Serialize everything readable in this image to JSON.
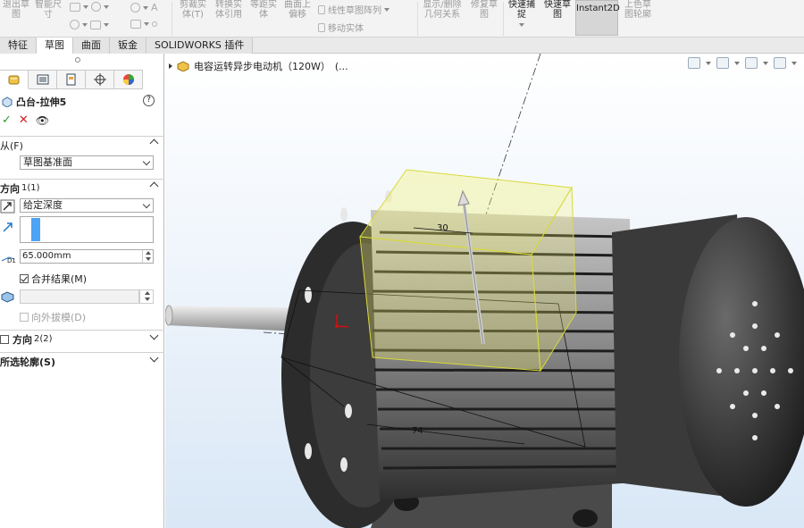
{
  "ribbon": {
    "groups": [
      {
        "line1": "退出草",
        "line2": "图"
      },
      {
        "line1": "智能尺",
        "line2": "寸"
      },
      {
        "line1": "剪裁实",
        "line2": "体(T)"
      },
      {
        "line1": "转换实",
        "line2": "体引用"
      },
      {
        "line1": "等距实",
        "line2": "体"
      },
      {
        "line1": "曲面上",
        "line2": "偏移"
      },
      {
        "line1": "显示/删除",
        "line2": "几何关系"
      },
      {
        "line1": "修复草",
        "line2": "图"
      },
      {
        "line1": "快速捕",
        "line2": "捉"
      },
      {
        "line1": "快速草",
        "line2": "图"
      },
      {
        "line1": "上色草",
        "line2": "图轮廓"
      }
    ],
    "linear_pattern": "线性草图阵列",
    "move_entity": "移动实体",
    "instant2d": "Instant2D"
  },
  "tabs": [
    "特征",
    "草图",
    "曲面",
    "钣金",
    "SOLIDWORKS 插件"
  ],
  "active_tab": "草图",
  "panel": {
    "feature_title": "凸台-拉伸5",
    "help": "?",
    "from": {
      "label": "从(F)",
      "value": "草图基准面"
    },
    "direction1": {
      "label": "方向",
      "sub": "1(1)",
      "end_condition": "给定深度",
      "depth": "65.000mm",
      "merge": "合并结果(M)",
      "draft": "向外拔模(D)"
    },
    "direction2": {
      "label": "方向",
      "sub": "2(2)"
    },
    "selected_contours": "所选轮廓(S)"
  },
  "viewport": {
    "tree_label": "电容运转异步电动机（120W）",
    "tree_suffix": "(...",
    "dim_30": "30",
    "dim_74": "74"
  },
  "colors": {
    "accent_blue": "#4da3f5",
    "preview_yellow": "#f2f06a",
    "motor_dark": "#2d2d2d"
  }
}
